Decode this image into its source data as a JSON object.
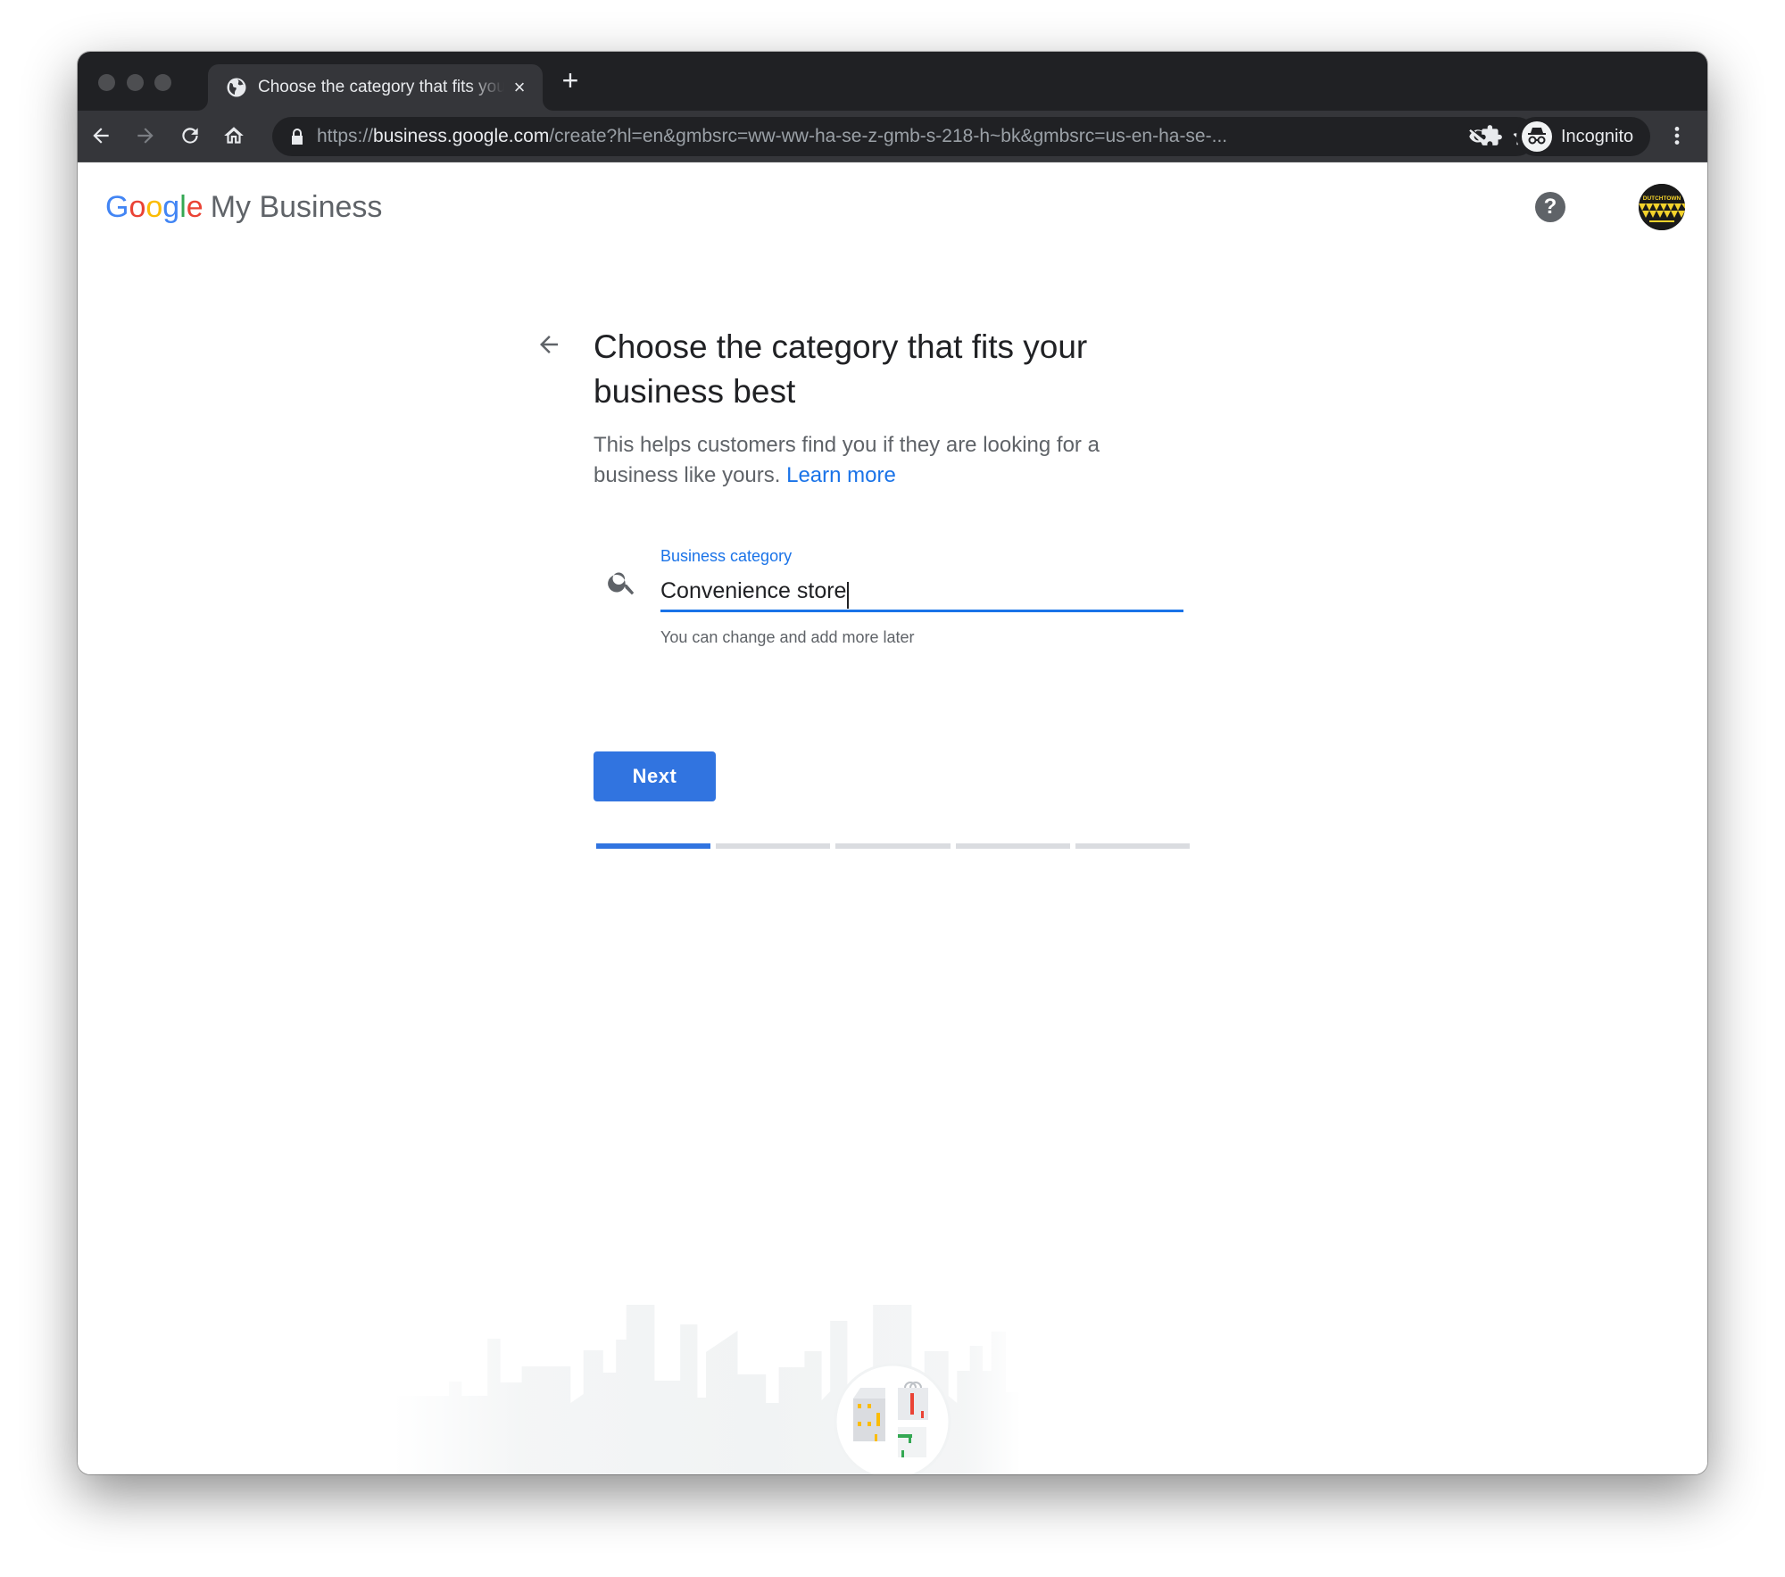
{
  "browser": {
    "tab": {
      "title": "Choose the category that fits your business best",
      "favicon": "globe-icon"
    },
    "new_tab_label": "+",
    "close_tab_label": "×",
    "url": {
      "scheme": "https://",
      "host": "business.google.com",
      "path": "/create?hl=en&gmbsrc=ww-ww-ha-se-z-gmb-s-218-h~bk&gmbsrc=us-en-ha-se-..."
    },
    "profile_label": "Incognito",
    "toolbar_icons": [
      "back-icon",
      "forward-icon",
      "reload-icon",
      "home-icon",
      "lock-icon",
      "eye-off-icon",
      "star-icon",
      "extensions-icon",
      "incognito-icon",
      "more-vert-icon"
    ]
  },
  "header": {
    "logo_google": [
      "G",
      "o",
      "o",
      "g",
      "l",
      "e"
    ],
    "logo_product": "My Business",
    "help_label": "?",
    "account_badge": "DUTCHTOWN"
  },
  "page": {
    "title": "Choose the category that fits your business best",
    "subtitle": "This helps customers find you if they are looking for a business like yours.",
    "learn_more": "Learn more",
    "field": {
      "label": "Business category",
      "value": "Convenience store",
      "helper": "You can change and add more later"
    },
    "next_label": "Next",
    "progress": {
      "current_step": 1,
      "total_steps": 5
    }
  },
  "colors": {
    "accent": "#1a73e8",
    "button": "#3174e0",
    "chrome_dark": "#202124",
    "chrome_toolbar": "#35363a",
    "progress_inactive": "#dadce0"
  }
}
